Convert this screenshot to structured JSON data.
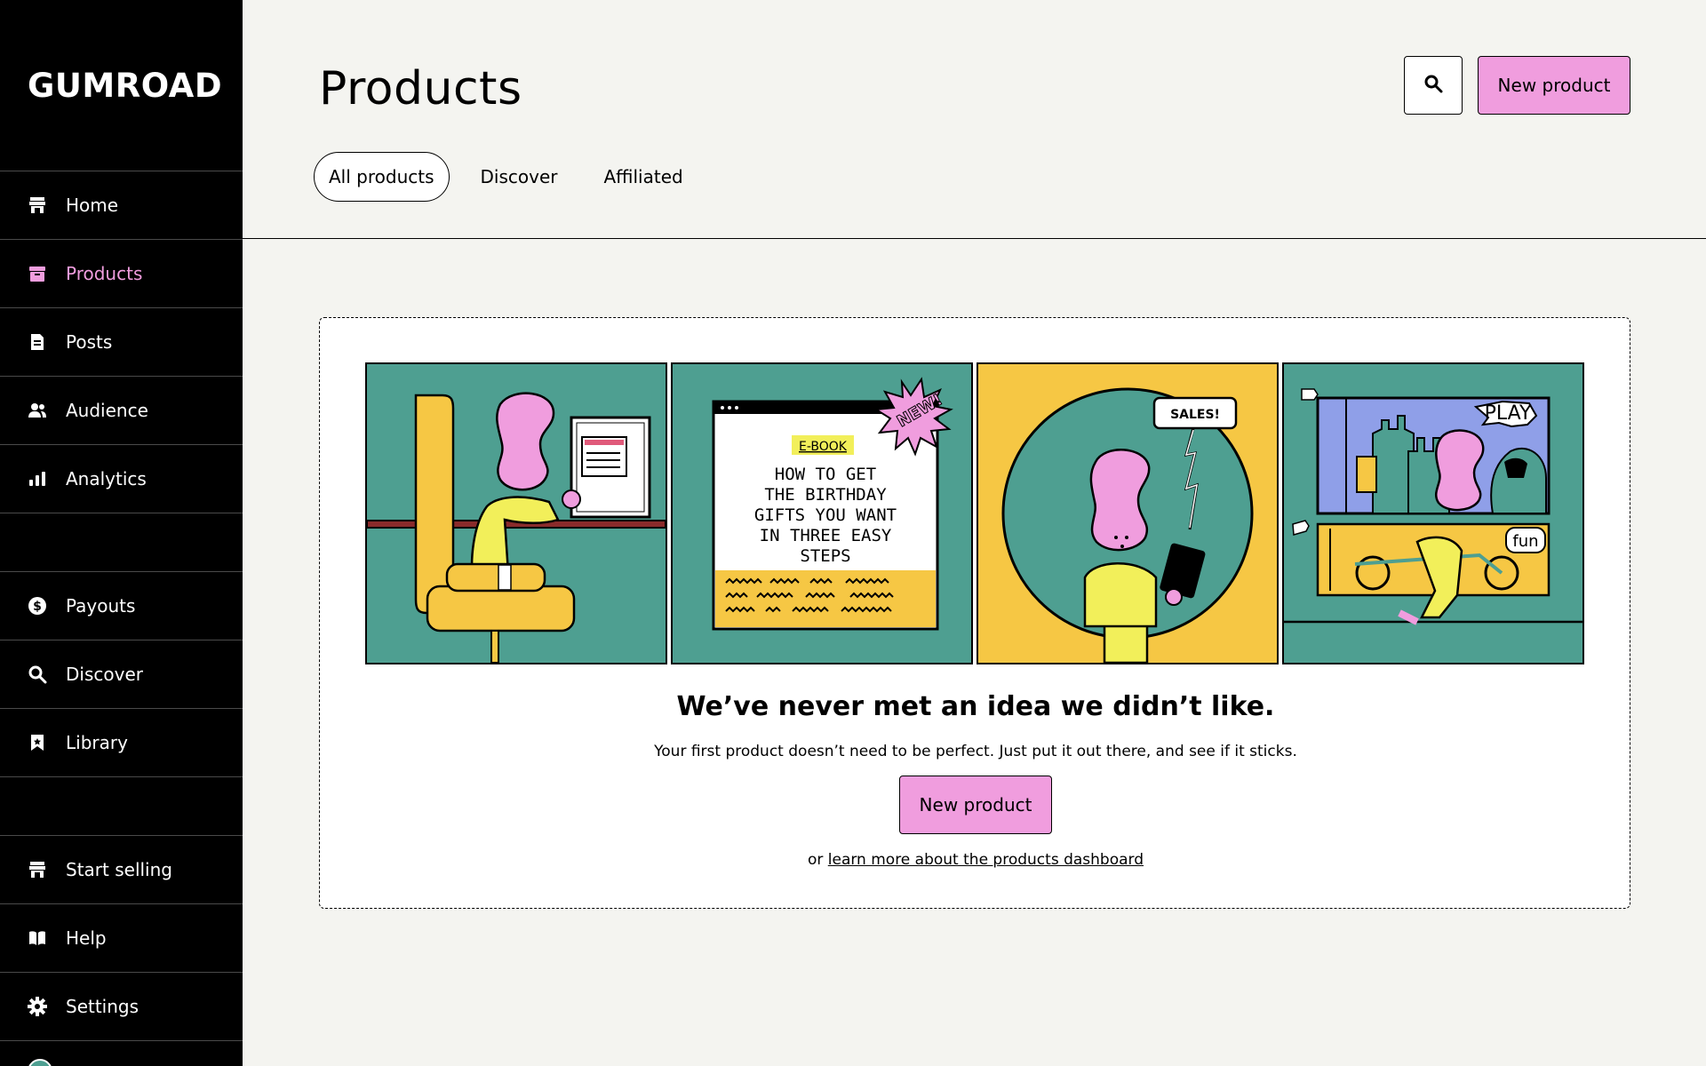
{
  "sidebar": {
    "logo": "GUMROAD",
    "items": [
      {
        "label": "Home",
        "icon": "store-icon"
      },
      {
        "label": "Products",
        "icon": "archive-icon"
      },
      {
        "label": "Posts",
        "icon": "document-icon"
      },
      {
        "label": "Audience",
        "icon": "people-icon"
      },
      {
        "label": "Analytics",
        "icon": "bar-chart-icon"
      },
      {
        "label": "Payouts",
        "icon": "dollar-circle-icon"
      },
      {
        "label": "Discover",
        "icon": "search-icon"
      },
      {
        "label": "Library",
        "icon": "bookmark-icon"
      },
      {
        "label": "Start selling",
        "icon": "store-icon"
      },
      {
        "label": "Help",
        "icon": "book-icon"
      },
      {
        "label": "Settings",
        "icon": "gear-icon"
      }
    ],
    "active_item": "Products"
  },
  "header": {
    "title": "Products",
    "new_product_label": "New product",
    "search_icon": "search-icon"
  },
  "tabs": [
    {
      "label": "All products",
      "active": true
    },
    {
      "label": "Discover",
      "active": false
    },
    {
      "label": "Affiliated",
      "active": false
    }
  ],
  "empty_state": {
    "panels": {
      "ebook_tag": "E-BOOK",
      "ebook_title_lines": [
        "HOW TO GET",
        "THE BIRTHDAY",
        "GIFTS YOU WANT",
        "IN THREE EASY",
        "STEPS"
      ],
      "burst_text": "NEW!",
      "speech_text": "SALES!",
      "play_text": "PLAY",
      "fun_text": "fun"
    },
    "headline": "We’ve never met an idea we didn’t like.",
    "subline": "Your first product doesn’t need to be perfect. Just put it out there, and see if it sticks.",
    "button_label": "New product",
    "learn_prefix": "or",
    "learn_link": "learn more about the products dashboard"
  },
  "colors": {
    "accent_pink": "#f09dde",
    "teal": "#4e9f91",
    "yellow": "#f6c744",
    "sidebar_bg": "#000000",
    "page_bg": "#f4f4f0"
  }
}
